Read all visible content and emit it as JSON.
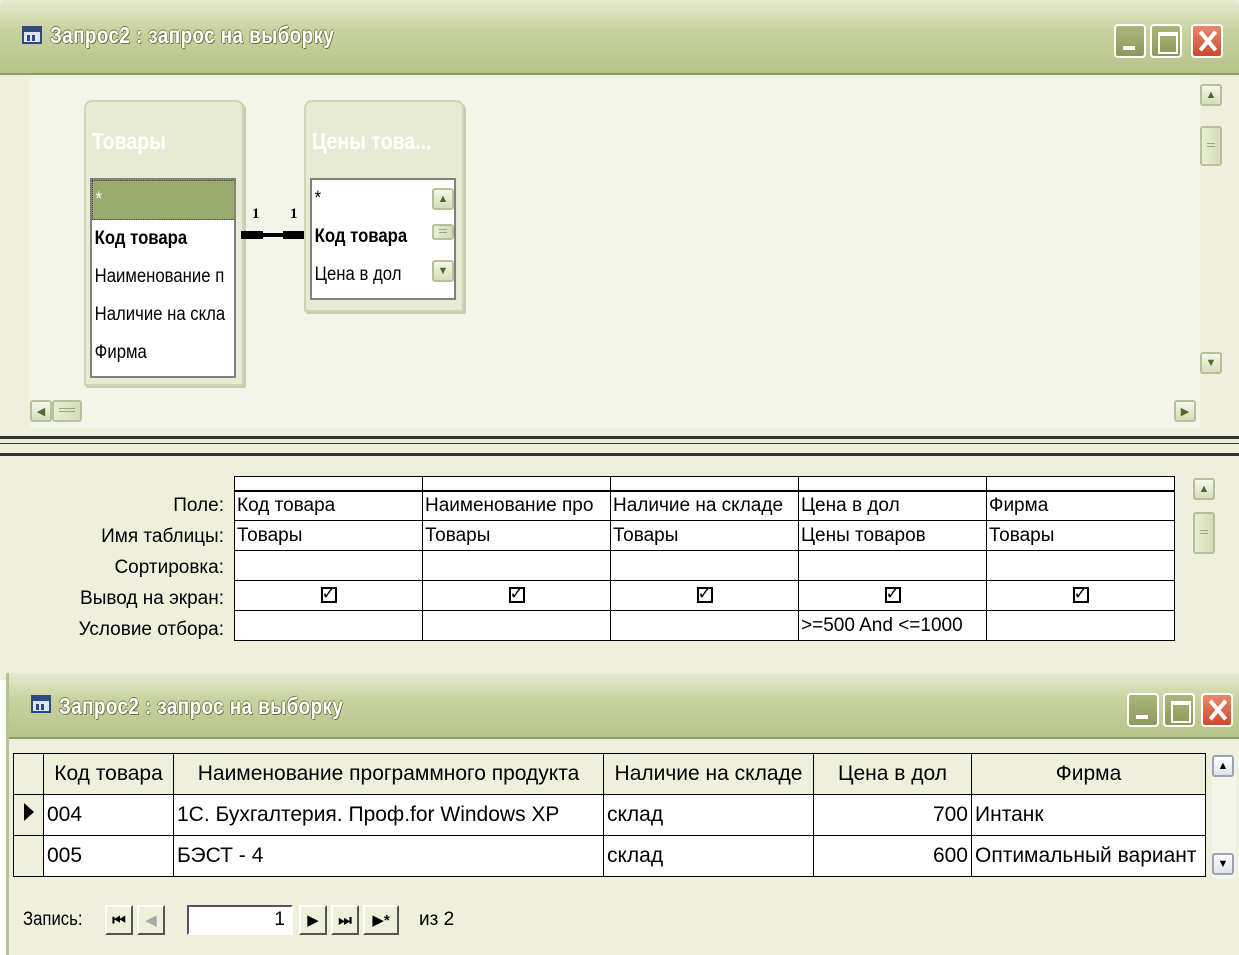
{
  "design_window": {
    "title": "Запрос2 : запрос на выборку",
    "tables": [
      {
        "title": "Товары",
        "fields": [
          "*",
          "Код товара",
          "Наименование п",
          "Наличие на скла",
          "Фирма"
        ]
      },
      {
        "title": "Цены това...",
        "fields": [
          "*",
          "Код товара",
          "Цена в дол"
        ]
      }
    ],
    "relationship": {
      "left_label": "1",
      "right_label": "1"
    },
    "row_labels": {
      "field": "Поле:",
      "table": "Имя таблицы:",
      "sort": "Сортировка:",
      "show": "Вывод на экран:",
      "criteria": "Условие отбора:"
    },
    "columns": [
      {
        "field": "Код товара",
        "table": "Товары",
        "sort": "",
        "show": true,
        "criteria": ""
      },
      {
        "field": "Наименование про",
        "table": "Товары",
        "sort": "",
        "show": true,
        "criteria": ""
      },
      {
        "field": "Наличие на складе",
        "table": "Товары",
        "sort": "",
        "show": true,
        "criteria": ""
      },
      {
        "field": "Цена в дол",
        "table": "Цены товаров",
        "sort": "",
        "show": true,
        "criteria": ">=500 And <=1000"
      },
      {
        "field": "Фирма",
        "table": "Товары",
        "sort": "",
        "show": true,
        "criteria": ""
      }
    ]
  },
  "datasheet_window": {
    "title": "Запрос2 : запрос на выборку",
    "headers": [
      "Код товара",
      "Наименование программного продукта",
      "Наличие на складе",
      "Цена в дол",
      "Фирма"
    ],
    "rows": [
      [
        "004",
        "1С. Бухгалтерия. Проф.for Windows XP",
        "склад",
        "700",
        "Интанк"
      ],
      [
        "005",
        "БЭСТ - 4",
        "склад",
        "600",
        "Оптимальный вариант"
      ]
    ],
    "navigation": {
      "label": "Запись:",
      "current": "1",
      "of_text": "из 2"
    }
  },
  "icons": {
    "first": "⏮",
    "prev": "◀",
    "next": "▶",
    "last": "⏭",
    "new": "▶*",
    "scroll_up": "▲",
    "scroll_down": "▼",
    "scroll_left": "◀",
    "scroll_right": "▶"
  },
  "colors": {
    "title_bar": "#b7c389",
    "window_bg": "#eef0dc",
    "close_button": "#c94b2c"
  }
}
